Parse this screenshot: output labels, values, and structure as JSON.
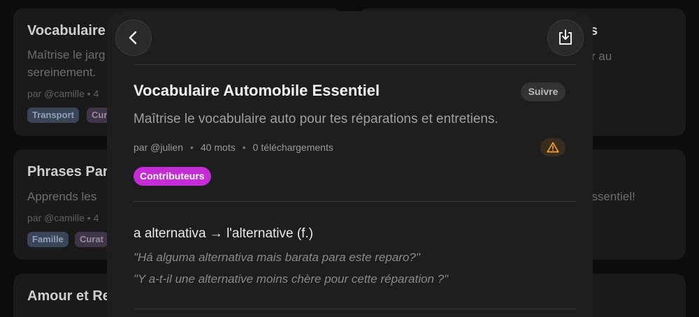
{
  "background_cards": [
    {
      "title": "Vocabulaire",
      "description_lines": [
        "Maîtrise le jarg",
        "sereinement."
      ],
      "meta": "par @camille • 4",
      "tags": [
        "Transport",
        "Cur"
      ]
    },
    {
      "title": "Phrases Par",
      "description_lines": [
        "Apprends les"
      ],
      "meta": "par @camille • 4",
      "tags": [
        "Famille",
        "Curat"
      ]
    },
    {
      "title": "Amour et Re",
      "description_lines": []
    },
    {
      "title": "s",
      "description_lines": [
        "r au"
      ]
    },
    {
      "title": "",
      "description_lines": [
        "essentiel!"
      ]
    }
  ],
  "modal": {
    "back_icon": "chevron-left-icon",
    "download_icon": "download-tray-icon",
    "title": "Vocabulaire Automobile Essentiel",
    "follow_label": "Suivre",
    "description": "Maîtrise le vocabulaire auto pour tes réparations et entretiens.",
    "author": "par @julien",
    "word_count": "40 mots",
    "downloads": "0 téléchargements",
    "warning_icon": "warning-icon",
    "tag": "Contributeurs",
    "entries": [
      {
        "term": "a alternativa → l'alternative (f.)",
        "example_source": "\"Há alguma alternativa mais barata para este reparo?\"",
        "example_target": "\"Y a-t-il une alternative moins chère pour cette réparation ?\""
      }
    ]
  },
  "colors": {
    "accent_tag": "#c42cd6",
    "warning": "#f0a23a",
    "background": "#0c0c0c",
    "modal": "#1e1e1e"
  }
}
